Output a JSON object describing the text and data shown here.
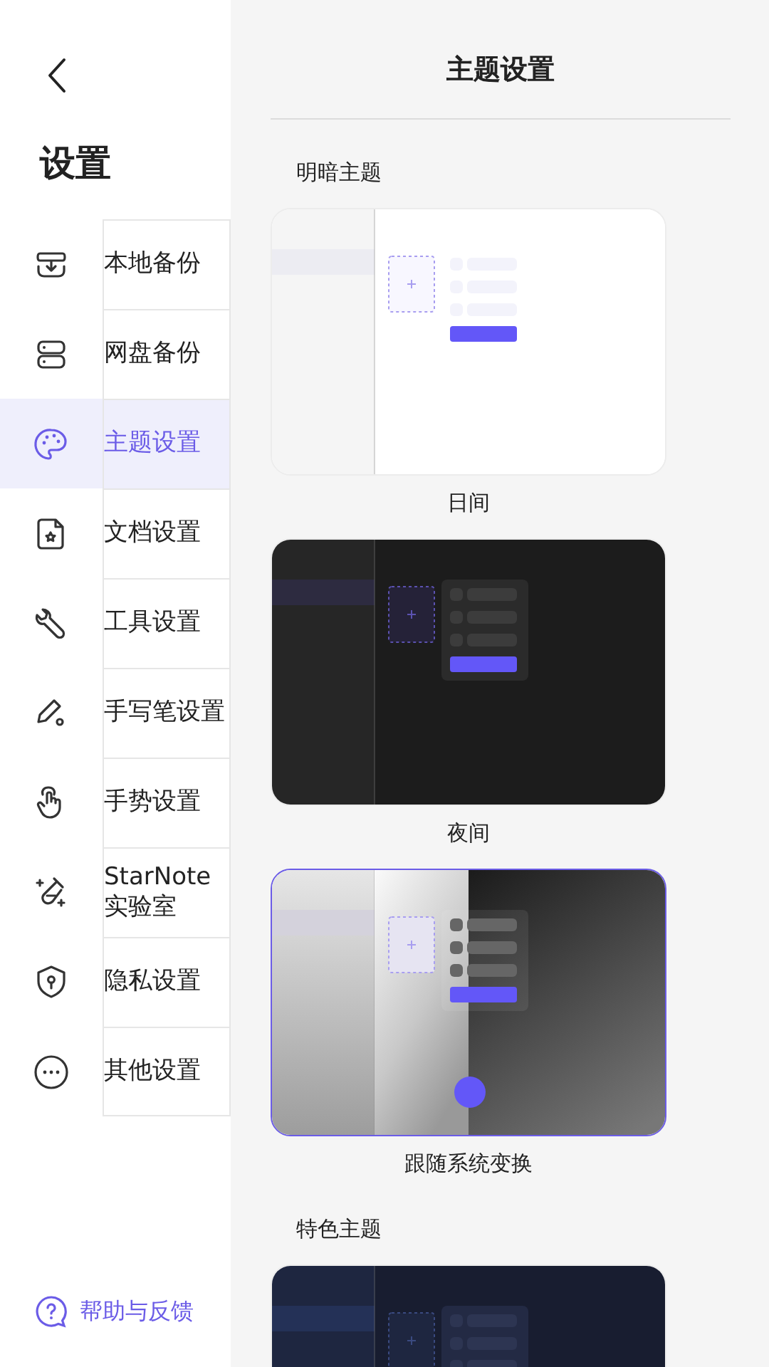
{
  "sidebar": {
    "title": "设置",
    "items": [
      {
        "label": "本地备份",
        "selected": false
      },
      {
        "label": "网盘备份",
        "selected": false
      },
      {
        "label": "主题设置",
        "selected": true
      },
      {
        "label": "文档设置",
        "selected": false
      },
      {
        "label": "工具设置",
        "selected": false
      },
      {
        "label": "手写笔设置",
        "selected": false
      },
      {
        "label": "手势设置",
        "selected": false
      },
      {
        "label": "StarNote 实验室",
        "selected": false
      },
      {
        "label": "隐私设置",
        "selected": false
      },
      {
        "label": "其他设置",
        "selected": false
      }
    ],
    "help_link": "帮助与反馈"
  },
  "header": {
    "title": "主题设置"
  },
  "sections": [
    {
      "title": "明暗主题",
      "themes": [
        {
          "kind": "day",
          "label": "日间",
          "selected": false
        },
        {
          "kind": "night",
          "label": "夜间",
          "selected": false
        },
        {
          "kind": "auto",
          "label": "跟随系统变换",
          "selected": true
        }
      ]
    },
    {
      "title": "特色主题",
      "themes": [
        {
          "kind": "navy",
          "selected": false
        }
      ]
    }
  ]
}
